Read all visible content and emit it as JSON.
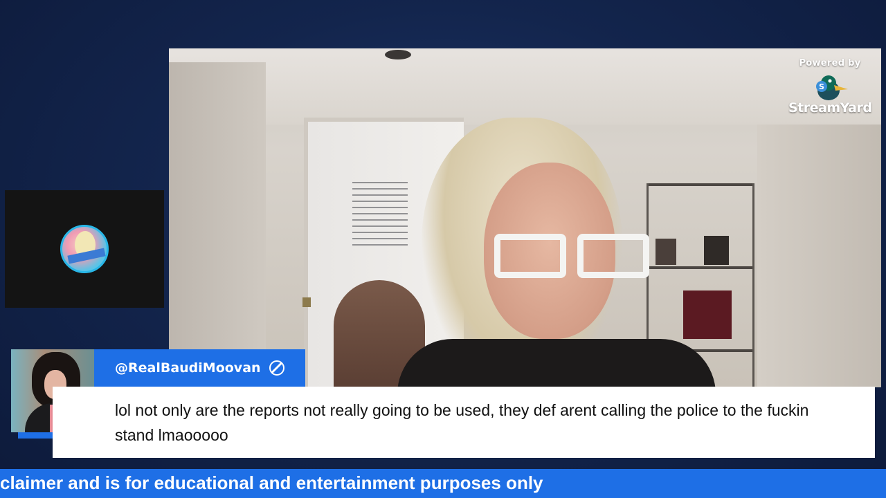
{
  "branding": {
    "powered_by": "Powered by",
    "stream_brand_part1": "Stream",
    "stream_brand_part2": "Yard",
    "logo_icon": "streamyard-duck-icon"
  },
  "comment": {
    "handle": "@RealBaudiMoovan",
    "handle_icon": "ban-icon",
    "message": "lol not only are the reports not really going to be used, they def arent calling the police to the fuckin stand lmaooooo",
    "platform_icon": "youtube-icon"
  },
  "ticker": {
    "text": "claimer and is for educational and entertainment purposes only"
  },
  "colors": {
    "accent": "#1e6fe6",
    "background": "#13254d",
    "comment_bg": "#ffffff"
  }
}
